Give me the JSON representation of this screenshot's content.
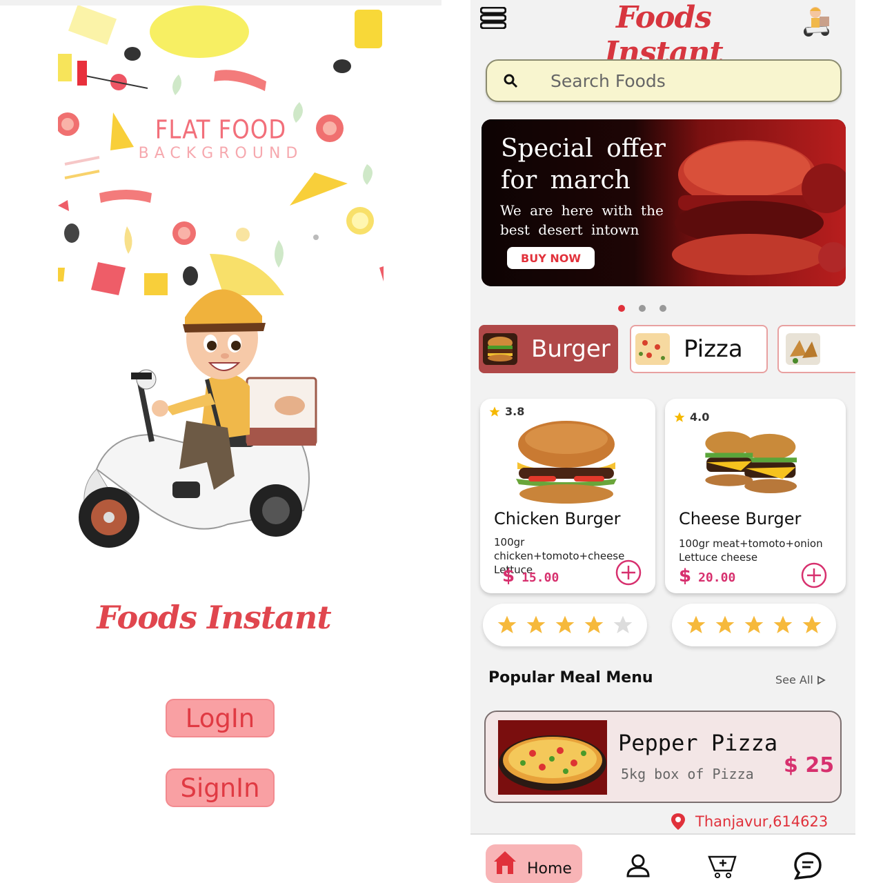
{
  "login_screen": {
    "background_title": "FLAT FOOD",
    "background_subtitle": "BACKGROUND",
    "brand": "Foods Instant",
    "login_label": "LogIn",
    "signin_label": "SignIn"
  },
  "home": {
    "brand": "Foods Instant",
    "search": {
      "placeholder": "Search Foods"
    },
    "banner": {
      "title": "Special offer for march",
      "subtitle": "We are here with the best desert intown",
      "button": "BUY NOW"
    },
    "carousel": {
      "count": 3,
      "active_index": 0
    },
    "categories": [
      {
        "label": "Burger",
        "active": true
      },
      {
        "label": "Pizza",
        "active": false
      },
      {
        "label": "",
        "active": false
      }
    ],
    "products": [
      {
        "rating": "3.8",
        "name": "Chicken Burger",
        "desc_line1": "100gr chicken+tomoto+cheese",
        "desc_line2": "Lettuce",
        "currency": "$",
        "price": "15.00",
        "stars": 4
      },
      {
        "rating": "4.0",
        "name": "Cheese Burger",
        "desc_line1": "100gr meat+tomoto+onion",
        "desc_line2": "Lettuce cheese",
        "currency": "$",
        "price": "20.00",
        "stars": 5
      }
    ],
    "popular": {
      "title": "Popular Meal Menu",
      "see_all": "See All",
      "item": {
        "name": "Pepper Pizza",
        "desc": "5kg box of Pizza",
        "price": "$ 25"
      }
    },
    "location": "Thanjavur,614623",
    "nav": {
      "home_label": "Home"
    },
    "colors": {
      "accent": "#e0313b",
      "price": "#d7306e",
      "active_category": "#b04848",
      "search_bg": "#f8f5cf"
    }
  }
}
